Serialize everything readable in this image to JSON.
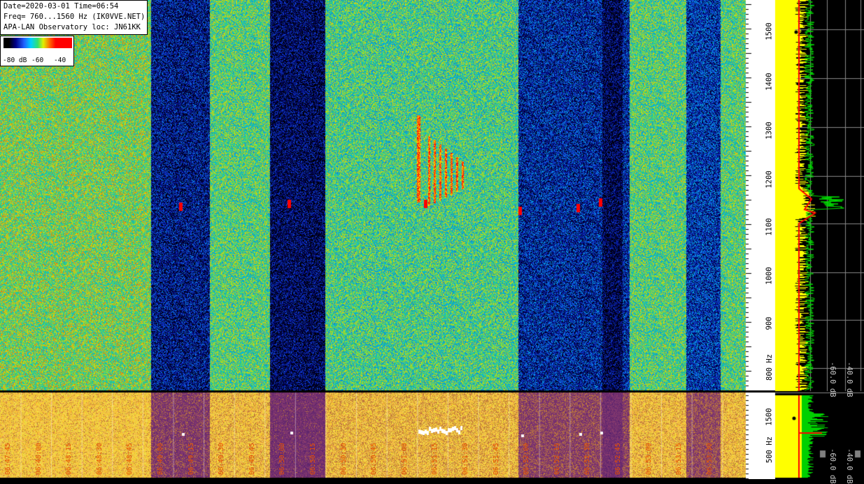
{
  "header": {
    "line1": "Date=2020-03-01 Time=06:54",
    "line2": "Freq= 760...1560 Hz (IK0VVE.NET)",
    "line3": "APA-LAN Observatory loc: JN61KK"
  },
  "colorbar": {
    "label_min": "-80 dB",
    "label_mid": "-60",
    "label_max": "-40"
  },
  "freq_axis": {
    "ticks": [
      "1500",
      "1400",
      "1300",
      "1200",
      "1100",
      "1000",
      "900",
      "800 Hz"
    ]
  },
  "lower_axis": {
    "ticks": [
      "1500",
      "500 Hz"
    ]
  },
  "db_labels": {
    "upper": [
      "-60.0 dB",
      "-40.0 dB"
    ],
    "lower": [
      "-60.0 dB",
      "-40.0 dB"
    ]
  },
  "time_labels": [
    "06:47:45",
    "06:48:00",
    "06:48:15",
    "06:48:30",
    "06:48:45",
    "06:49:00",
    "06:49:15",
    "06:49:30",
    "06:49:45",
    "06:50:00",
    "06:50:15",
    "06:50:30",
    "06:50:45",
    "06:51:00",
    "06:51:15",
    "06:51:30",
    "06:51:45",
    "06:52:00",
    "06:52:15",
    "06:52:30",
    "06:52:45",
    "06:53:00",
    "06:53:15",
    "06:53:30"
  ],
  "colors": {
    "time_label": "#e65000",
    "spectrum_fill": "#ffff00",
    "spectrum_peak": "#00e000",
    "marker": "#ff0000"
  }
}
